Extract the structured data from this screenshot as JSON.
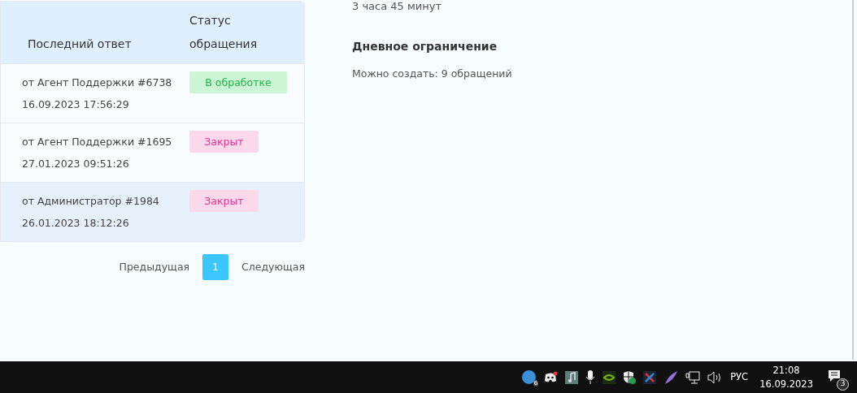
{
  "table": {
    "columns": [
      "Последний ответ",
      "Статус обращения"
    ],
    "rows": [
      {
        "author": "от Агент Поддержки #6738",
        "date": "16.09.2023 17:56:29",
        "status": "В обработке",
        "kind": "in_progress",
        "selected": false
      },
      {
        "author": "от Агент Поддержки #1695",
        "date": "27.01.2023 09:51:26",
        "status": "Закрыт",
        "kind": "closed",
        "selected": false
      },
      {
        "author": "от Администратор #1984",
        "date": "26.01.2023 18:12:26",
        "status": "Закрыт",
        "kind": "closed",
        "selected": true
      }
    ]
  },
  "pagination": {
    "previous": "Предыдущая",
    "pages": [
      {
        "label": "1",
        "selected": true
      }
    ],
    "next": "Следующая"
  },
  "info": {
    "time_left": "3 часа 45 минут",
    "daily_limit_title": "Дневное ограничение",
    "daily_limit_text": "Можно создать: 9 обращений"
  },
  "taskbar": {
    "tray_badge": "6",
    "language": "РУС",
    "time": "21:08",
    "date": "16.09.2023",
    "notifications": "3"
  }
}
